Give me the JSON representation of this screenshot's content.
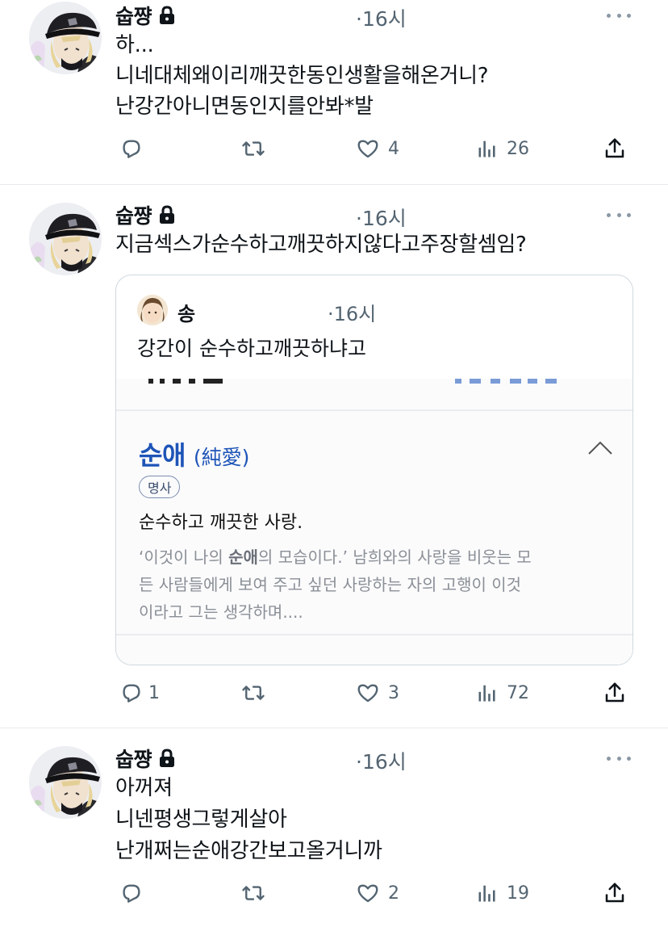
{
  "colors": {
    "text": "#0f1419",
    "secondary": "#536471",
    "divider": "#e6e9ec",
    "dict_blue": "#1e54b7"
  },
  "tweets": [
    {
      "author": "숩쨩",
      "locked": true,
      "time": "·16시",
      "lines": [
        "하...",
        "니네대체왜이리깨끗한동인생활을해온거니?",
        "난강간아니면동인지를안봐*발"
      ],
      "replies": "",
      "retweets": "",
      "likes": "4",
      "views": "26"
    },
    {
      "author": "숩쨩",
      "locked": true,
      "time": "·16시",
      "lines": [
        "지금섹스가순수하고깨끗하지않다고주장할셈임?"
      ],
      "quote": {
        "author": "송",
        "time": "·16시",
        "text": "강간이 순수하고깨끗하냐고",
        "dictionary": {
          "headword": "순애",
          "hanja": "(純愛)",
          "pos": "명사",
          "definition": "순수하고 깨끗한 사랑.",
          "example_lines": [
            "‘이것이 나의 ",
            "순애",
            "의 모습이다.’ 남희와의 사랑을 비웃는 모",
            "든 사람들에게 보여 주고 싶던 사랑하는 자의 고행이 이것",
            "이라고 그는 생각하며...."
          ]
        }
      },
      "replies": "1",
      "retweets": "",
      "likes": "3",
      "views": "72"
    },
    {
      "author": "숩쨩",
      "locked": true,
      "time": "·16시",
      "lines": [
        "아꺼져",
        "니넨평생그렇게살아",
        "난개쩌는순애강간보고올거니까"
      ],
      "replies": "",
      "retweets": "",
      "likes": "2",
      "views": "19"
    }
  ],
  "icons": {
    "lock": "lock-icon",
    "more": "more-icon",
    "reply": "reply-icon",
    "retweet": "retweet-icon",
    "like": "heart-icon",
    "views": "views-icon",
    "share": "share-icon",
    "collapse": "chevron-up-icon"
  }
}
